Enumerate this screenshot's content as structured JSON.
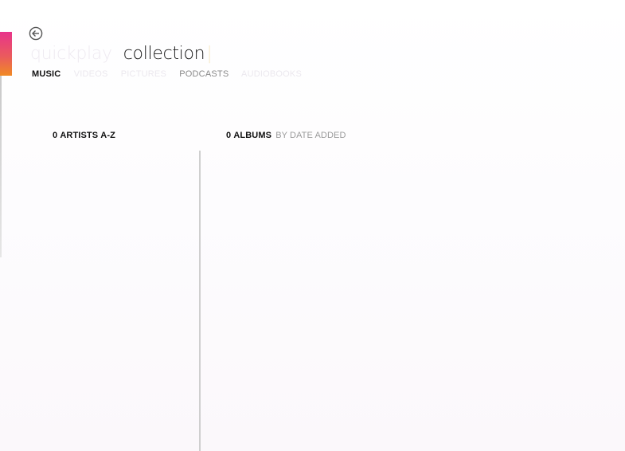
{
  "nav": {
    "back_icon": "back-arrow-circle-icon"
  },
  "pivot": {
    "items": [
      {
        "label": "quickplay",
        "active": false
      },
      {
        "label": "collection",
        "active": true
      }
    ]
  },
  "subtabs": {
    "items": [
      {
        "label": "MUSIC",
        "selected": true
      },
      {
        "label": "VIDEOS",
        "selected": false
      },
      {
        "label": "PICTURES",
        "selected": false
      },
      {
        "label": "PODCASTS",
        "selected": false
      },
      {
        "label": "AUDIOBOOKS",
        "selected": false
      }
    ]
  },
  "artists": {
    "count": "0",
    "label": "ARTISTS",
    "sort": "A-Z"
  },
  "albums": {
    "count": "0",
    "label": "ALBUMS",
    "sort": "BY DATE ADDED"
  },
  "colors": {
    "accent_top": "#e8338b",
    "accent_bottom": "#f08a24",
    "inactive_text": "#eeeaf1",
    "secondary_text": "#9a9a9a",
    "divider": "#cfcfcf"
  }
}
